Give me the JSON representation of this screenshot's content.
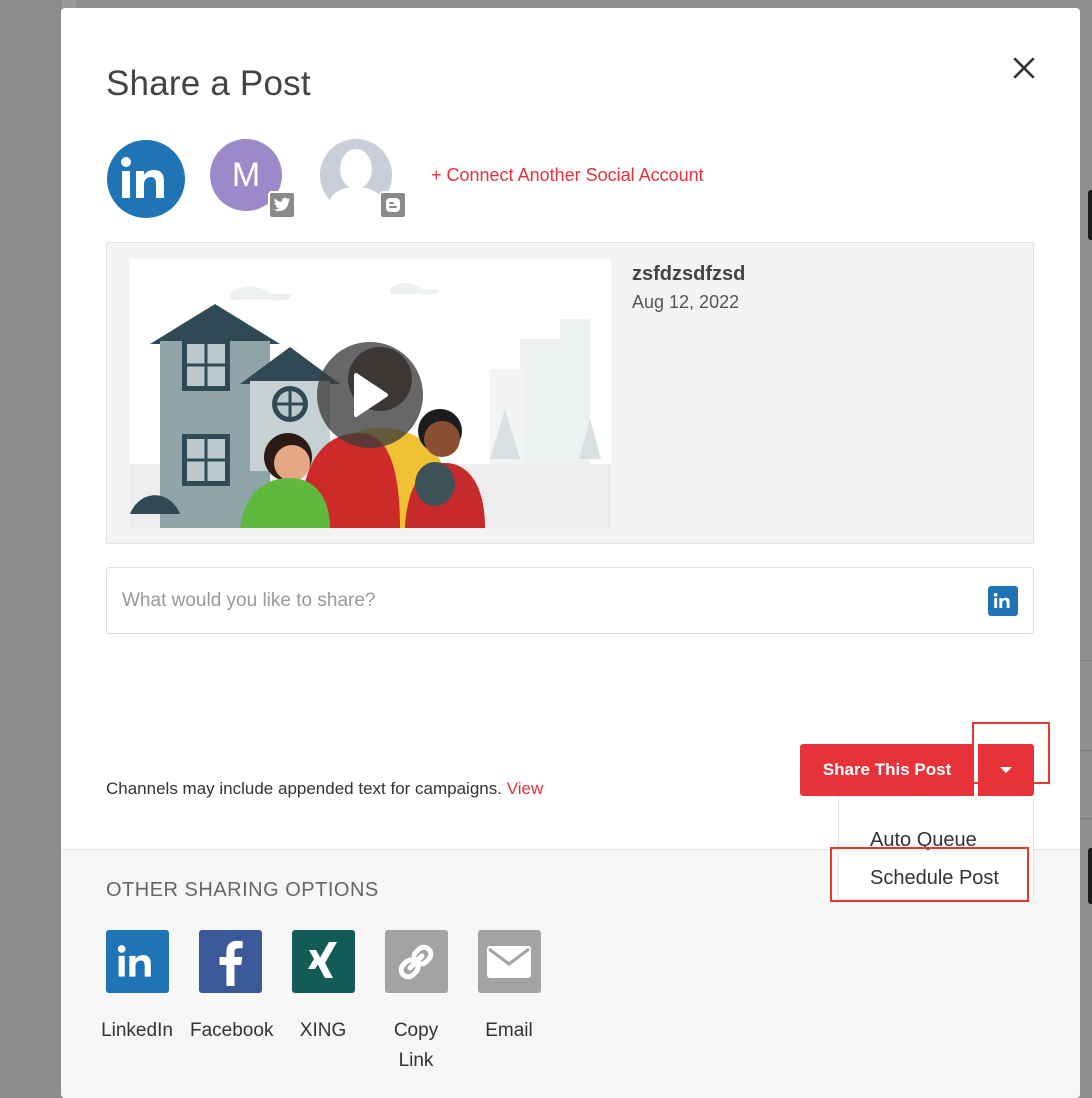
{
  "modal": {
    "title": "Share a Post"
  },
  "accounts": {
    "linkedin_icon": "linkedin-icon",
    "twitter_account_initial": "M",
    "twitter_badge_icon": "twitter-icon",
    "blogger_badge_icon": "blogger-icon",
    "connect_label": "+ Connect Another Social Account"
  },
  "post": {
    "title": "zsfdzsdfzsd",
    "date": "Aug 12, 2022"
  },
  "share_input": {
    "placeholder": "What would you like to share?",
    "value": ""
  },
  "note": {
    "text": "Channels may include appended text for campaigns.",
    "link": "View"
  },
  "actions": {
    "share_label": "Share This Post",
    "dropdown_items": [
      "Auto Queue",
      "Schedule Post"
    ]
  },
  "other_options": {
    "title": "OTHER SHARING OPTIONS",
    "items": [
      {
        "label": "LinkedIn",
        "icon": "linkedin-icon",
        "color": "#1f74b6"
      },
      {
        "label": "Facebook",
        "icon": "facebook-icon",
        "color": "#3b5998"
      },
      {
        "label": "XING",
        "icon": "xing-icon",
        "color": "#125b57"
      },
      {
        "label": "Copy Link",
        "icon": "link-icon",
        "color": "#a3a3a3"
      },
      {
        "label": "Email",
        "icon": "email-icon",
        "color": "#a3a3a3"
      }
    ]
  },
  "colors": {
    "accent": "#e8323a",
    "linkedin": "#1f74b6",
    "highlight": "#e23a2d"
  }
}
